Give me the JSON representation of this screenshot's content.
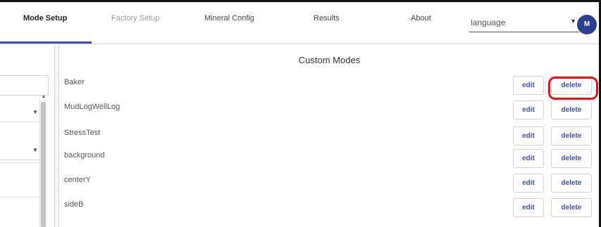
{
  "nav": {
    "tabs": [
      {
        "label": "Mode Setup",
        "active": true
      },
      {
        "label": "Factory Setup",
        "active": false
      },
      {
        "label": "Mineral Config",
        "active": false
      },
      {
        "label": "Results",
        "active": false
      },
      {
        "label": "About",
        "active": false
      }
    ],
    "language": {
      "value": "language"
    },
    "avatar_initial": "M"
  },
  "main": {
    "title": "Custom Modes",
    "modes": [
      {
        "name": "Baker",
        "edit_label": "edit",
        "delete_label": "delete"
      },
      {
        "name": "MudLogWellLog",
        "edit_label": "edit",
        "delete_label": "delete"
      },
      {
        "name": "StressTest",
        "edit_label": "edit",
        "delete_label": "delete"
      },
      {
        "name": "background",
        "edit_label": "edit",
        "delete_label": "delete"
      },
      {
        "name": "centerY",
        "edit_label": "edit",
        "delete_label": "delete"
      },
      {
        "name": "sideB",
        "edit_label": "edit",
        "delete_label": "delete"
      }
    ]
  },
  "colors": {
    "accent": "#3f51b5",
    "avatar_bg": "#2b3f8f",
    "highlight": "#e3151a"
  },
  "icons": {
    "dropdown": "chevron-down-icon"
  }
}
